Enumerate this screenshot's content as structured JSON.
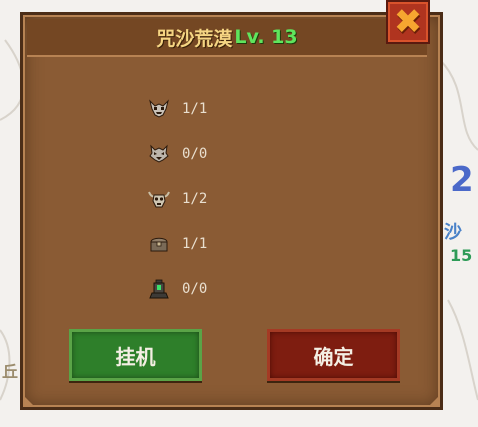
{
  "dialog": {
    "title_name": "咒沙荒漠",
    "title_level": "Lv. 13",
    "close_glyph": "✖"
  },
  "rows": [
    {
      "icon": "horned-skull-icon",
      "count": "1/1"
    },
    {
      "icon": "demon-mask-icon",
      "count": "0/0"
    },
    {
      "icon": "bull-skull-icon",
      "count": "1/2"
    },
    {
      "icon": "treasure-chest-icon",
      "count": "1/1"
    },
    {
      "icon": "lantern-icon",
      "count": "0/0"
    }
  ],
  "buttons": {
    "idle_label": "挂机",
    "confirm_label": "确定"
  },
  "background": {
    "right_text": "沙",
    "right_number": "15",
    "left_text": "丘"
  },
  "colors": {
    "panel": "#8a5b34",
    "title_text": "#f5d583",
    "level_text": "#5fe55d",
    "green_button": "#2e7f2a",
    "red_button": "#7e1d10"
  }
}
